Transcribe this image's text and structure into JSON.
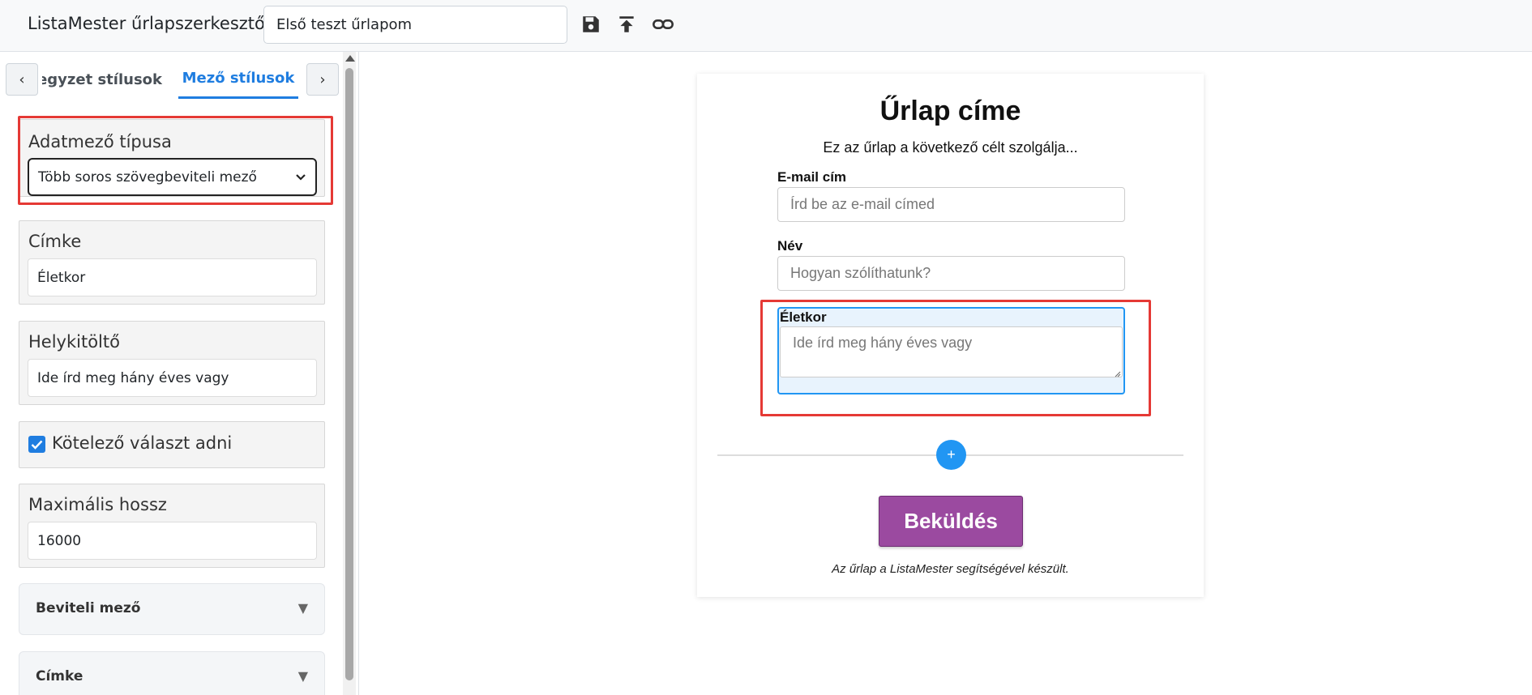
{
  "header": {
    "app_title": "ListaMester űrlapszerkesztő:",
    "form_name": "Első teszt űrlapom"
  },
  "sidebar": {
    "tabs": [
      {
        "label": "Jegyzet stílusok",
        "active": false
      },
      {
        "label": "Mező stílusok",
        "active": true
      }
    ],
    "field_type": {
      "label": "Adatmező típusa",
      "value": "Több soros szövegbeviteli mező"
    },
    "label_field": {
      "label": "Címke",
      "value": "Életkor"
    },
    "placeholder_field": {
      "label": "Helykitöltő",
      "value": "Ide írd meg hány éves vagy"
    },
    "required": {
      "label": "Kötelező választ adni",
      "checked": true
    },
    "max_length": {
      "label": "Maximális hossz",
      "value": "16000"
    },
    "accordions": [
      {
        "label": "Beviteli mező"
      },
      {
        "label": "Címke"
      }
    ]
  },
  "form": {
    "title": "Űrlap címe",
    "description": "Ez az űrlap a következő célt szolgálja...",
    "fields": [
      {
        "label": "E-mail cím",
        "placeholder": "Írd be az e-mail címed"
      },
      {
        "label": "Név",
        "placeholder": "Hogyan szólíthatunk?"
      },
      {
        "label": "Életkor",
        "placeholder": "Ide írd meg hány éves vagy"
      }
    ],
    "add_label": "+",
    "submit_label": "Beküldés",
    "footer": "Az űrlap a ListaMester segítségével készült."
  },
  "colors": {
    "accent": "#1f7de0",
    "submit": "#9b4aa0",
    "highlight": "#e53935"
  }
}
